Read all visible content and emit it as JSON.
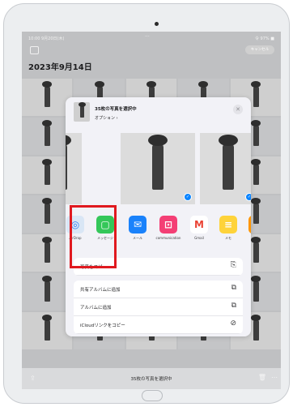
{
  "status": {
    "time": "10:00 9月20日(木)",
    "dots": "···",
    "battery": "令 97% ■"
  },
  "topbar": {
    "select_label": "キャンセル",
    "date_title": "2023年9月14日"
  },
  "bottombar": {
    "selected_label": "35枚の写真を選択中"
  },
  "share_sheet": {
    "title": "35枚の写真を選択中",
    "options_label": "オプション ›",
    "close_glyph": "✕",
    "apps": [
      {
        "name": "AirDrop",
        "label": "AirDrop",
        "color": "#d9e6f5",
        "glyph_color": "#2f7df6",
        "glyph": "◎"
      },
      {
        "name": "messages",
        "label": "メッセージ",
        "color": "#34c759",
        "glyph_color": "#ffffff",
        "glyph": "▢"
      },
      {
        "name": "mail",
        "label": "メール",
        "color": "#1a82fb",
        "glyph_color": "#ffffff",
        "glyph": "✉"
      },
      {
        "name": "lecture",
        "label": "communication",
        "color": "#f43f75",
        "glyph_color": "#ffffff",
        "glyph": "⊡"
      },
      {
        "name": "gmail",
        "label": "Gmail",
        "color": "#ffffff",
        "glyph_color": "#ea4335",
        "glyph": "M"
      },
      {
        "name": "notes",
        "label": "メモ",
        "color": "#fed33a",
        "glyph_color": "#ffffff",
        "glyph": "≡"
      },
      {
        "name": "partial-app",
        "label": "",
        "color": "#ff9500",
        "glyph_color": "#ffffff",
        "glyph": ""
      }
    ],
    "actions_group1": [
      {
        "label": "写真をコピー",
        "icon": "⎘"
      }
    ],
    "actions_group2": [
      {
        "label": "共有アルバムに追加",
        "icon": "⧉"
      },
      {
        "label": "アルバムに追加",
        "icon": "⧉"
      },
      {
        "label": "iCloudリンクをコピー",
        "icon": "⊘"
      }
    ],
    "check_glyph": "✓"
  },
  "icons": {
    "share": "share-icon",
    "trash": "trash-icon",
    "more": "more-icon"
  },
  "highlight_color": "#e0191f"
}
